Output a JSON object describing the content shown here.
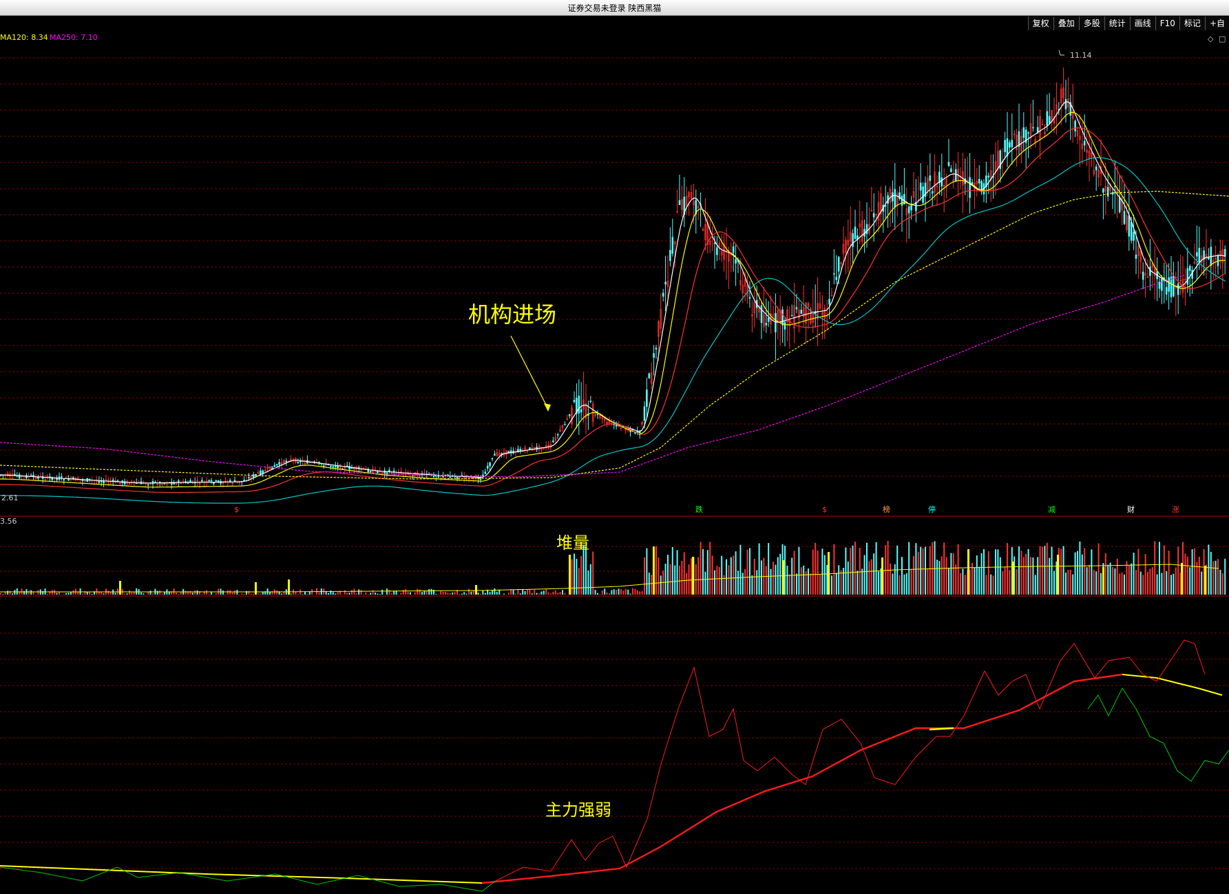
{
  "window": {
    "title": "证券交易未登录  陕西黑猫"
  },
  "toolbar": [
    "复权",
    "叠加",
    "多股",
    "统计",
    "画线",
    "F10",
    "标记",
    "+自"
  ],
  "indicators": {
    "ma120": "MA120: 8.34",
    "ma250": "MA250: 7.10"
  },
  "price": {
    "high_label": "11.14",
    "low_label": "2.61"
  },
  "volume": {
    "axis_label": "3.56"
  },
  "annotations": {
    "entry": "机构进场",
    "volume": "堆量",
    "strength": "主力强弱"
  },
  "event_markers": [
    "$",
    "跌",
    "$",
    "榜",
    "停",
    "减",
    "财",
    "涨"
  ],
  "colors": {
    "up": "#ff3232",
    "down": "#54ffff",
    "ma5": "#ffffff",
    "ma10": "#ffff00",
    "ma20": "#ff3232",
    "ma60": "#00c8c8",
    "ma120": "#ffff00",
    "ma250": "#ff00ff",
    "annotation": "#ffff00",
    "marker_green": "#00ff00"
  },
  "chart_data": {
    "type": "candlestick",
    "ma_lines": [
      "MA5",
      "MA10",
      "MA20",
      "MA60",
      "MA120",
      "MA250"
    ],
    "price_range": [
      2.61,
      11.14
    ],
    "volume_max": 3.56,
    "strength_line_colors": [
      "yellow",
      "red",
      "green"
    ]
  }
}
